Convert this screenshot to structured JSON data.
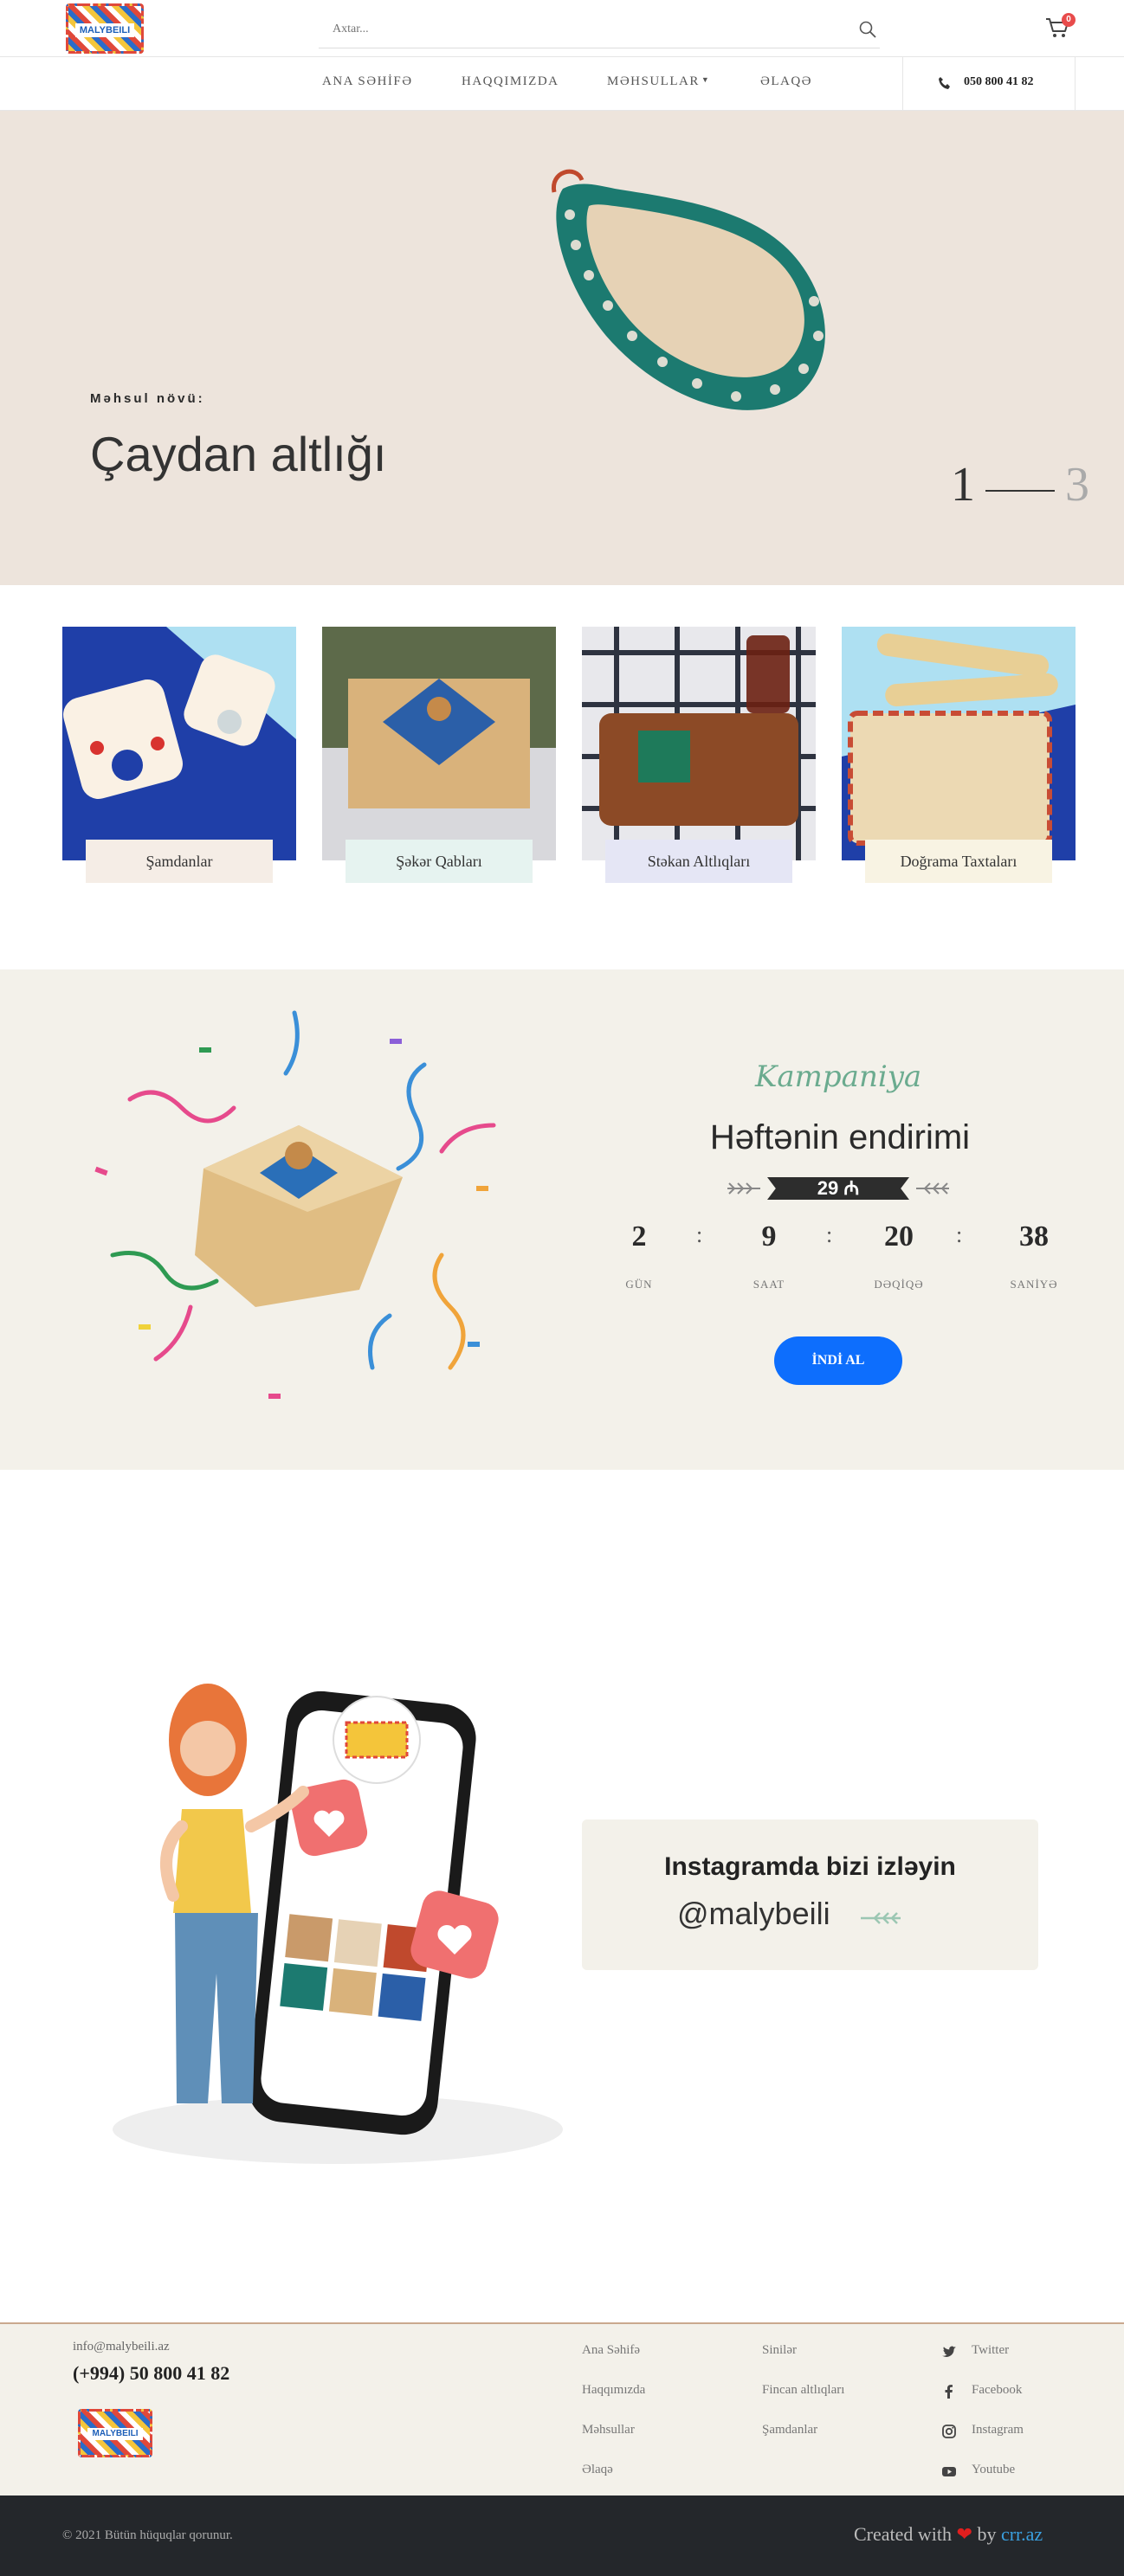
{
  "header": {
    "logo_text": "MALYBEILI",
    "search_placeholder": "Axtar...",
    "cart_count": "0"
  },
  "nav": {
    "items": [
      "ANA SƏHİFƏ",
      "HAQQIMIZDA",
      "MƏHSULLAR",
      "ƏLAQƏ"
    ],
    "phone": "050 800 41 82"
  },
  "hero": {
    "kicker": "Məhsul növü:",
    "title": "Çaydan altlığı",
    "slide_current": "1",
    "slide_total": "3"
  },
  "categories": [
    {
      "label": "Şamdanlar",
      "bg": "#f5ede6"
    },
    {
      "label": "Şəkər Qabları",
      "bg": "#e6f3f0"
    },
    {
      "label": "Stəkan Altlıqları",
      "bg": "#e5e6f5"
    },
    {
      "label": "Doğrama Taxtaları",
      "bg": "#f8f3e3"
    }
  ],
  "campaign": {
    "script": "Kampaniya",
    "title": "Həftənin endirimi",
    "price": "29 ₼",
    "countdown": [
      {
        "value": "2",
        "label": "GÜN"
      },
      {
        "value": "9",
        "label": "SAAT"
      },
      {
        "value": "20",
        "label": "DƏQİQƏ"
      },
      {
        "value": "38",
        "label": "SANİYƏ"
      }
    ],
    "button": "İNDİ AL"
  },
  "instagram": {
    "title": "Instagramda bizi izləyin",
    "handle": "@malybeili"
  },
  "footer": {
    "email": "info@malybeili.az",
    "phone": "(+994) 50 800 41 82",
    "logo_text": "MALYBEILI",
    "col1": [
      "Ana Səhifə",
      "Haqqımızda",
      "Məhsullar",
      "Əlaqə"
    ],
    "col2": [
      "Sinilər",
      "Fincan altlıqları",
      "Şamdanlar"
    ],
    "social": [
      "Twitter",
      "Facebook",
      "Instagram",
      "Youtube"
    ],
    "copyright": "© 2021 Bütün hüquqlar qorunur.",
    "made_with": "Created with",
    "made_by_word": "by",
    "made_by": "crr.az"
  },
  "colors": {
    "accent": "#0d6efd",
    "hero_bg": "#ede4dc",
    "campaign_bg": "#f3f1ea",
    "footer_dark": "#24272b",
    "script_green": "#6bab8f"
  }
}
